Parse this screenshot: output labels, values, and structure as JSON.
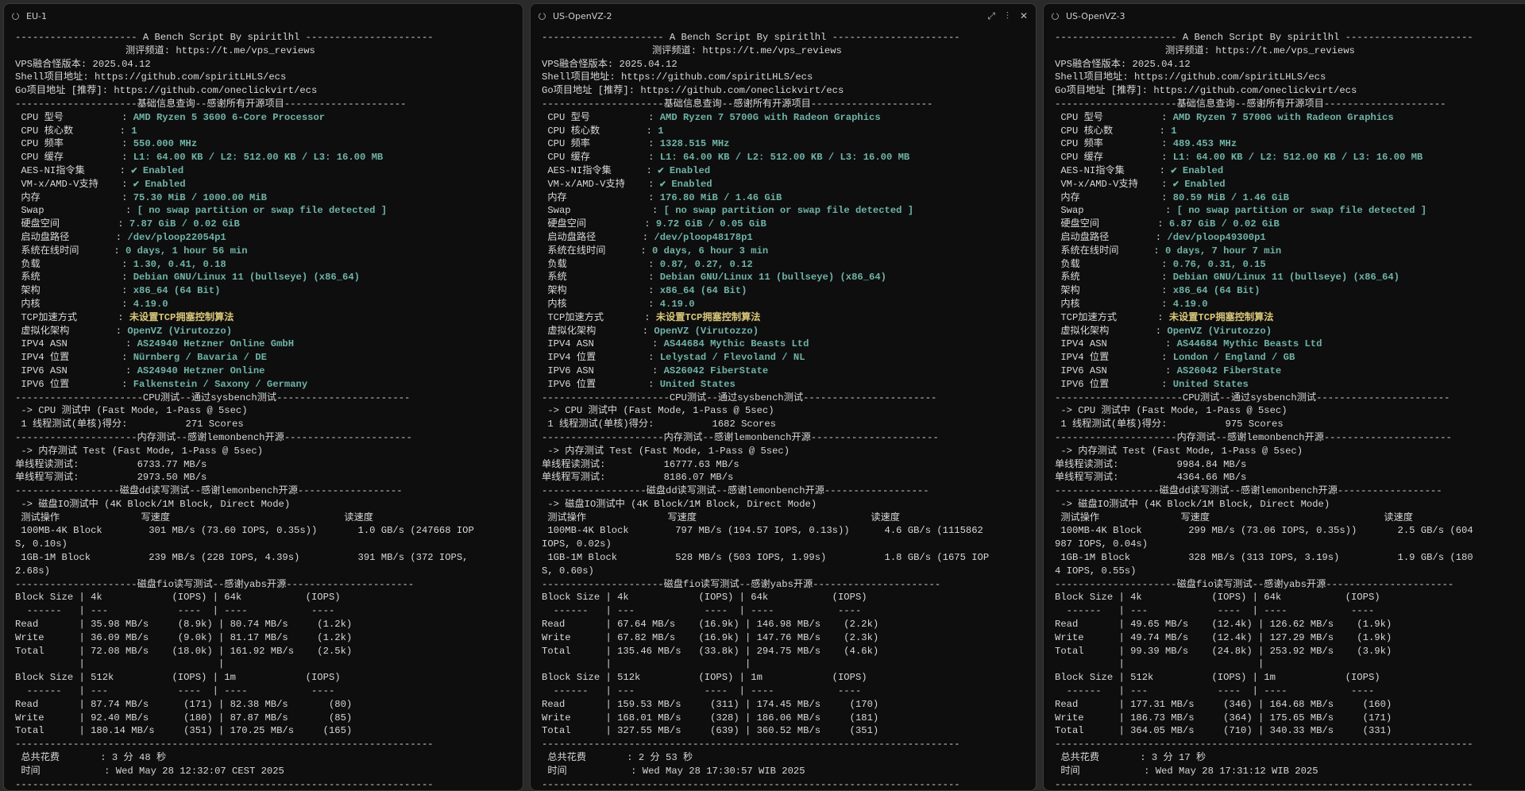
{
  "panes": [
    {
      "title": "EU-1",
      "lines": [
        "--------------------- A Bench Script By spiritlhl ----------------------",
        "                   测评频道: https://t.me/vps_reviews",
        "VPS融合怪版本: 2025.04.12",
        "Shell项目地址: https://github.com/spiritLHLS/ecs",
        "Go项目地址 [推荐]: https://github.com/oneclickvirt/ecs",
        "---------------------基础信息查询--感谢所有开源项目---------------------",
        [
          " CPU 型号          : ",
          "AMD Ryzen 5 3600 6-Core Processor"
        ],
        [
          " CPU 核心数        : ",
          "1"
        ],
        [
          " CPU 频率          : ",
          "550.000 MHz"
        ],
        [
          " CPU 缓存          : ",
          "L1: 64.00 KB / L2: 512.00 KB / L3: 16.00 MB"
        ],
        [
          " AES-NI指令集      : ",
          "✔ Enabled"
        ],
        [
          " VM-x/AMD-V支持    : ",
          "✔ Enabled"
        ],
        [
          " 内存              : ",
          "75.30 MiB / 1000.00 MiB"
        ],
        [
          " Swap              : ",
          "[ no swap partition or swap file detected ]"
        ],
        [
          " 硬盘空间          : ",
          "7.87 GiB / 0.02 GiB"
        ],
        [
          " 启动盘路径        : ",
          "/dev/ploop22054p1"
        ],
        [
          " 系统在线时间      : ",
          "0 days, 1 hour 56 min"
        ],
        [
          " 负载              : ",
          "1.30, 0.41, 0.18"
        ],
        [
          " 系统              : ",
          "Debian GNU/Linux 11 (bullseye) (x86_64)"
        ],
        [
          " 架构              : ",
          "x86_64 (64 Bit)"
        ],
        [
          " 内核              : ",
          "4.19.0"
        ],
        [
          " TCP加速方式       : ",
          "未设置TCP拥塞控制算法",
          "warn"
        ],
        [
          " 虚拟化架构        : ",
          "OpenVZ (Virutozzo)"
        ],
        [
          " IPV4 ASN          : ",
          "AS24940 Hetzner Online GmbH"
        ],
        [
          " IPV4 位置         : ",
          "Nürnberg / Bavaria / DE"
        ],
        [
          " IPV6 ASN          : ",
          "AS24940 Hetzner Online"
        ],
        [
          " IPV6 位置         : ",
          "Falkenstein / Saxony / Germany"
        ],
        "----------------------CPU测试--通过sysbench测试-----------------------",
        " -> CPU 测试中 (Fast Mode, 1-Pass @ 5sec)",
        " 1 线程测试(单核)得分:          271 Scores",
        "---------------------内存测试--感谢lemonbench开源----------------------",
        " -> 内存测试 Test (Fast Mode, 1-Pass @ 5sec)",
        "单线程读测试:          6733.77 MB/s",
        "单线程写测试:          2973.50 MB/s",
        "------------------磁盘dd读写测试--感谢lemonbench开源------------------",
        " -> 磁盘IO测试中 (4K Block/1M Block, Direct Mode)",
        " 测试操作              写速度                              读速度",
        " 100MB-4K Block        301 MB/s (73.60 IOPS, 0.35s))       1.0 GB/s (247668 IOP",
        "S, 0.10s)",
        " 1GB-1M Block          239 MB/s (228 IOPS, 4.39s)          391 MB/s (372 IOPS,",
        "2.68s)",
        "---------------------磁盘fio读写测试--感谢yabs开源----------------------",
        "Block Size | 4k            (IOPS) | 64k           (IOPS)",
        "  ------   | ---            ----  | ----           ----",
        "Read       | 35.98 MB/s     (8.9k) | 80.74 MB/s     (1.2k)",
        "Write      | 36.09 MB/s     (9.0k) | 81.17 MB/s     (1.2k)",
        "Total      | 72.08 MB/s    (18.0k) | 161.92 MB/s    (2.5k)",
        "           |                       |",
        "Block Size | 512k          (IOPS) | 1m            (IOPS)",
        "  ------   | ---            ----  | ----           ----",
        "Read       | 87.74 MB/s      (171) | 82.38 MB/s       (80)",
        "Write      | 92.40 MB/s      (180) | 87.87 MB/s       (85)",
        "Total      | 180.14 MB/s     (351) | 170.25 MB/s     (165)",
        "------------------------------------------------------------------------",
        " 总共花费       : 3 分 48 秒",
        " 时间           : Wed May 28 12:32:07 CEST 2025",
        "------------------------------------------------------------------------"
      ]
    },
    {
      "title": "US-OpenVZ-2",
      "lines": [
        "--------------------- A Bench Script By spiritlhl ----------------------",
        "                   测评频道: https://t.me/vps_reviews",
        "VPS融合怪版本: 2025.04.12",
        "Shell项目地址: https://github.com/spiritLHLS/ecs",
        "Go项目地址 [推荐]: https://github.com/oneclickvirt/ecs",
        "---------------------基础信息查询--感谢所有开源项目---------------------",
        [
          " CPU 型号          : ",
          "AMD Ryzen 7 5700G with Radeon Graphics"
        ],
        [
          " CPU 核心数        : ",
          "1"
        ],
        [
          " CPU 频率          : ",
          "1328.515 MHz"
        ],
        [
          " CPU 缓存          : ",
          "L1: 64.00 KB / L2: 512.00 KB / L3: 16.00 MB"
        ],
        [
          " AES-NI指令集      : ",
          "✔ Enabled"
        ],
        [
          " VM-x/AMD-V支持    : ",
          "✔ Enabled"
        ],
        [
          " 内存              : ",
          "176.80 MiB / 1.46 GiB"
        ],
        [
          " Swap              : ",
          "[ no swap partition or swap file detected ]"
        ],
        [
          " 硬盘空间          : ",
          "9.72 GiB / 0.05 GiB"
        ],
        [
          " 启动盘路径        : ",
          "/dev/ploop48178p1"
        ],
        [
          " 系统在线时间      : ",
          "0 days, 6 hour 3 min"
        ],
        [
          " 负载              : ",
          "0.87, 0.27, 0.12"
        ],
        [
          " 系统              : ",
          "Debian GNU/Linux 11 (bullseye) (x86_64)"
        ],
        [
          " 架构              : ",
          "x86_64 (64 Bit)"
        ],
        [
          " 内核              : ",
          "4.19.0"
        ],
        [
          " TCP加速方式       : ",
          "未设置TCP拥塞控制算法",
          "warn"
        ],
        [
          " 虚拟化架构        : ",
          "OpenVZ (Virutozzo)"
        ],
        [
          " IPV4 ASN          : ",
          "AS44684 Mythic Beasts Ltd"
        ],
        [
          " IPV4 位置         : ",
          "Lelystad / Flevoland / NL"
        ],
        [
          " IPV6 ASN          : ",
          "AS26042 FiberState"
        ],
        [
          " IPV6 位置         : ",
          "United States"
        ],
        "----------------------CPU测试--通过sysbench测试-----------------------",
        " -> CPU 测试中 (Fast Mode, 1-Pass @ 5sec)",
        " 1 线程测试(单核)得分:          1682 Scores",
        "---------------------内存测试--感谢lemonbench开源----------------------",
        " -> 内存测试 Test (Fast Mode, 1-Pass @ 5sec)",
        "单线程读测试:          16777.63 MB/s",
        "单线程写测试:          8186.07 MB/s",
        "------------------磁盘dd读写测试--感谢lemonbench开源------------------",
        " -> 磁盘IO测试中 (4K Block/1M Block, Direct Mode)",
        " 测试操作              写速度                              读速度",
        " 100MB-4K Block        797 MB/s (194.57 IOPS, 0.13s))      4.6 GB/s (1115862",
        "IOPS, 0.02s)",
        " 1GB-1M Block          528 MB/s (503 IOPS, 1.99s)          1.8 GB/s (1675 IOP",
        "S, 0.60s)",
        "---------------------磁盘fio读写测试--感谢yabs开源----------------------",
        "Block Size | 4k            (IOPS) | 64k           (IOPS)",
        "  ------   | ---            ----  | ----           ----",
        "Read       | 67.64 MB/s    (16.9k) | 146.98 MB/s    (2.2k)",
        "Write      | 67.82 MB/s    (16.9k) | 147.76 MB/s    (2.3k)",
        "Total      | 135.46 MB/s   (33.8k) | 294.75 MB/s    (4.6k)",
        "           |                       |",
        "Block Size | 512k          (IOPS) | 1m            (IOPS)",
        "  ------   | ---            ----  | ----           ----",
        "Read       | 159.53 MB/s     (311) | 174.45 MB/s     (170)",
        "Write      | 168.01 MB/s     (328) | 186.06 MB/s     (181)",
        "Total      | 327.55 MB/s     (639) | 360.52 MB/s     (351)",
        "------------------------------------------------------------------------",
        " 总共花费       : 2 分 53 秒",
        " 时间           : Wed May 28 17:30:57 WIB 2025",
        "------------------------------------------------------------------------"
      ]
    },
    {
      "title": "US-OpenVZ-3",
      "lines": [
        "--------------------- A Bench Script By spiritlhl ----------------------",
        "                   测评频道: https://t.me/vps_reviews",
        "VPS融合怪版本: 2025.04.12",
        "Shell项目地址: https://github.com/spiritLHLS/ecs",
        "Go项目地址 [推荐]: https://github.com/oneclickvirt/ecs",
        "---------------------基础信息查询--感谢所有开源项目---------------------",
        [
          " CPU 型号          : ",
          "AMD Ryzen 7 5700G with Radeon Graphics"
        ],
        [
          " CPU 核心数        : ",
          "1"
        ],
        [
          " CPU 频率          : ",
          "489.453 MHz"
        ],
        [
          " CPU 缓存          : ",
          "L1: 64.00 KB / L2: 512.00 KB / L3: 16.00 MB"
        ],
        [
          " AES-NI指令集      : ",
          "✔ Enabled"
        ],
        [
          " VM-x/AMD-V支持    : ",
          "✔ Enabled"
        ],
        [
          " 内存              : ",
          "80.59 MiB / 1.46 GiB"
        ],
        [
          " Swap              : ",
          "[ no swap partition or swap file detected ]"
        ],
        [
          " 硬盘空间          : ",
          "6.87 GiB / 0.02 GiB"
        ],
        [
          " 启动盘路径        : ",
          "/dev/ploop49300p1"
        ],
        [
          " 系统在线时间      : ",
          "0 days, 7 hour 7 min"
        ],
        [
          " 负载              : ",
          "0.76, 0.31, 0.15"
        ],
        [
          " 系统              : ",
          "Debian GNU/Linux 11 (bullseye) (x86_64)"
        ],
        [
          " 架构              : ",
          "x86_64 (64 Bit)"
        ],
        [
          " 内核              : ",
          "4.19.0"
        ],
        [
          " TCP加速方式       : ",
          "未设置TCP拥塞控制算法",
          "warn"
        ],
        [
          " 虚拟化架构        : ",
          "OpenVZ (Virutozzo)"
        ],
        [
          " IPV4 ASN          : ",
          "AS44684 Mythic Beasts Ltd"
        ],
        [
          " IPV4 位置         : ",
          "London / England / GB"
        ],
        [
          " IPV6 ASN          : ",
          "AS26042 FiberState"
        ],
        [
          " IPV6 位置         : ",
          "United States"
        ],
        "----------------------CPU测试--通过sysbench测试-----------------------",
        " -> CPU 测试中 (Fast Mode, 1-Pass @ 5sec)",
        " 1 线程测试(单核)得分:          975 Scores",
        "---------------------内存测试--感谢lemonbench开源----------------------",
        " -> 内存测试 Test (Fast Mode, 1-Pass @ 5sec)",
        "单线程读测试:          9984.84 MB/s",
        "单线程写测试:          4364.66 MB/s",
        "------------------磁盘dd读写测试--感谢lemonbench开源------------------",
        " -> 磁盘IO测试中 (4K Block/1M Block, Direct Mode)",
        " 测试操作              写速度                              读速度",
        " 100MB-4K Block        299 MB/s (73.06 IOPS, 0.35s))       2.5 GB/s (604",
        "987 IOPS, 0.04s)",
        " 1GB-1M Block          328 MB/s (313 IOPS, 3.19s)          1.9 GB/s (180",
        "4 IOPS, 0.55s)",
        "---------------------磁盘fio读写测试--感谢yabs开源----------------------",
        "Block Size | 4k            (IOPS) | 64k           (IOPS)",
        "  ------   | ---            ----  | ----           ----",
        "Read       | 49.65 MB/s    (12.4k) | 126.62 MB/s    (1.9k)",
        "Write      | 49.74 MB/s    (12.4k) | 127.29 MB/s    (1.9k)",
        "Total      | 99.39 MB/s    (24.8k) | 253.92 MB/s    (3.9k)",
        "           |                       |",
        "Block Size | 512k          (IOPS) | 1m            (IOPS)",
        "  ------   | ---            ----  | ----           ----",
        "Read       | 177.31 MB/s     (346) | 164.68 MB/s     (160)",
        "Write      | 186.73 MB/s     (364) | 175.65 MB/s     (171)",
        "Total      | 364.05 MB/s     (710) | 340.33 MB/s     (331)",
        "------------------------------------------------------------------------",
        " 总共花费       : 3 分 17 秒",
        " 时间           : Wed May 28 17:31:12 WIB 2025",
        "------------------------------------------------------------------------"
      ]
    }
  ],
  "pane_actions": {
    "expand_icon": "⤢",
    "split_icon": "⫶",
    "close_icon": "✕"
  }
}
